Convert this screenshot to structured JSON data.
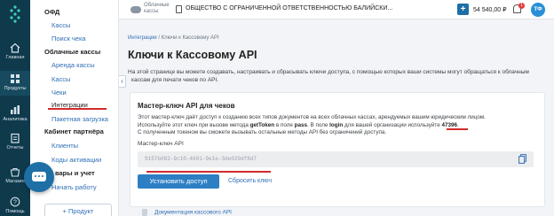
{
  "rail": {
    "items": [
      {
        "label": "Главная"
      },
      {
        "label": "Продукты"
      },
      {
        "label": "Аналитика"
      },
      {
        "label": "Отчеты"
      },
      {
        "label": "Магазин"
      },
      {
        "label": "Помощь"
      }
    ]
  },
  "menu": {
    "ofd_title": "ОФД",
    "ofd_items": [
      "Кассы",
      "Поиск чека"
    ],
    "cloud_title": "Облачные кассы",
    "cloud_items": [
      "Аренда кассы",
      "Кассы",
      "Чеки",
      "Интеграции",
      "Пакетная загрузка"
    ],
    "partner_title": "Кабинет партнёра",
    "partner_items": [
      "Клиенты",
      "Коды активации"
    ],
    "goods_title": "вары и учет",
    "goods_items": [
      "Начать работу"
    ],
    "add_button": "+ Продукт"
  },
  "topbar": {
    "cloud_label_1": "Облачные",
    "cloud_label_2": "кассы",
    "org_name": "ОБЩЕСТВО С ОГРАНИЧЕННОЙ ОТВЕТСТВЕННОСТЬЮ БАЛИЙСКИ...",
    "plus": "+",
    "balance": "54 540,00 ₽",
    "notifications": "1",
    "avatar": "ТФ"
  },
  "main": {
    "crumb_1": "Интеграции",
    "crumb_sep": "/",
    "crumb_2": "Ключи к Кассовому API",
    "title": "Ключи к Кассовому API",
    "intro_1": "На этой странице вы можете создавать, настраивать и сбрасывать ключи доступа, с помощью которых ваши системы могут обращаться к облачным",
    "intro_2": "кассам для печати чеков по API.",
    "card": {
      "title": "Мастер-ключ API для чеков",
      "desc_1": "Этот мастер-ключ даёт доступ к созданию всех типов документов на всех облачных кассах, арендуемых вашим юридическим лицом.",
      "desc_2a": "Используйте этот ключ при вызове метода ",
      "desc_2b": "getToken",
      "desc_2c": " в поле ",
      "desc_2d": "pass",
      "desc_2e": ". В поле ",
      "desc_2f": "login",
      "desc_2g": " для вашей организации используйте ",
      "desc_2h": "47396",
      "desc_2i": ".",
      "desc_3": "С полученным токеном вы сможете вызывать остальные методы API без ограничений доступа.",
      "key_label": "Мастер-ключ API",
      "key_value": "9157b082-9c10-4601-9e1e-3de029df8d7",
      "set_button": "Установить доступ",
      "reset_link": "Сбросить ключ"
    },
    "doc_link": "Документация кассового API"
  }
}
